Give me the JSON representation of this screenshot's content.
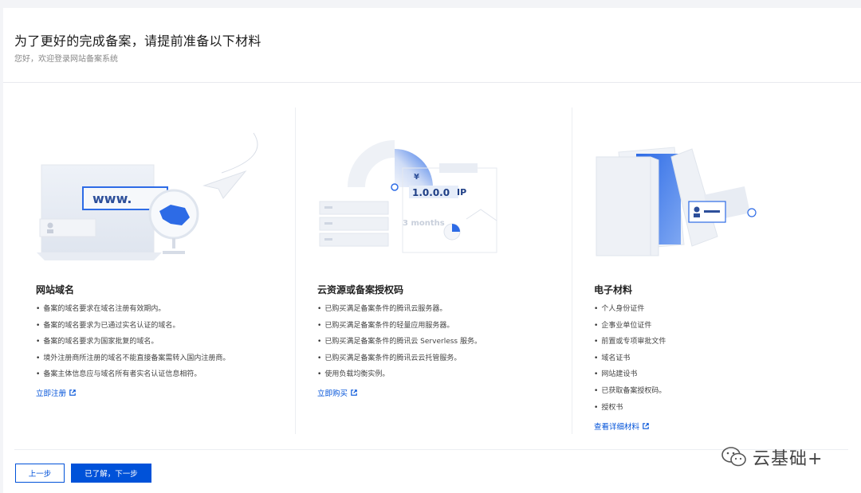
{
  "header": {
    "title": "为了更好的完成备案，请提前准备以下材料",
    "subtitle": "您好，欢迎登录网站备案系统"
  },
  "columns": [
    {
      "title": "网站域名",
      "illustration_text": "www.",
      "items": [
        "备案的域名要求在域名注册有效期内。",
        "备案的域名要求为已通过实名认证的域名。",
        "备案的域名要求为国家批复的域名。",
        "境外注册商所注册的域名不能直接备案需转入国内注册商。",
        "备案主体信息应与域名所有者实名认证信息相符。"
      ],
      "link": "立即注册"
    },
    {
      "title": "云资源或备案授权码",
      "illustration_texts": {
        "currency": "¥",
        "ip": "1.0.0.0",
        "ip_suffix": "IP",
        "duration": "3 months"
      },
      "items": [
        "已购买满足备案条件的腾讯云服务器。",
        "已购买满足备案条件的轻量应用服务器。",
        "已购买满足备案条件的腾讯云 Serverless 服务。",
        "已购买满足备案条件的腾讯云云托管服务。",
        "使用负载均衡实例。"
      ],
      "link": "立即购买"
    },
    {
      "title": "电子材料",
      "items": [
        "个人身份证件",
        "企事业单位证件",
        "前置或专项审批文件",
        "域名证书",
        "网站建设书",
        "已获取备案授权码。",
        "授权书"
      ],
      "link": "查看详细材料"
    }
  ],
  "footer": {
    "prev_label": "上一步",
    "next_label": "已了解，下一步"
  },
  "watermark": {
    "text": "云基础+"
  },
  "colors": {
    "accent": "#0052d9",
    "border": "#eceef2",
    "muted": "#888888"
  }
}
